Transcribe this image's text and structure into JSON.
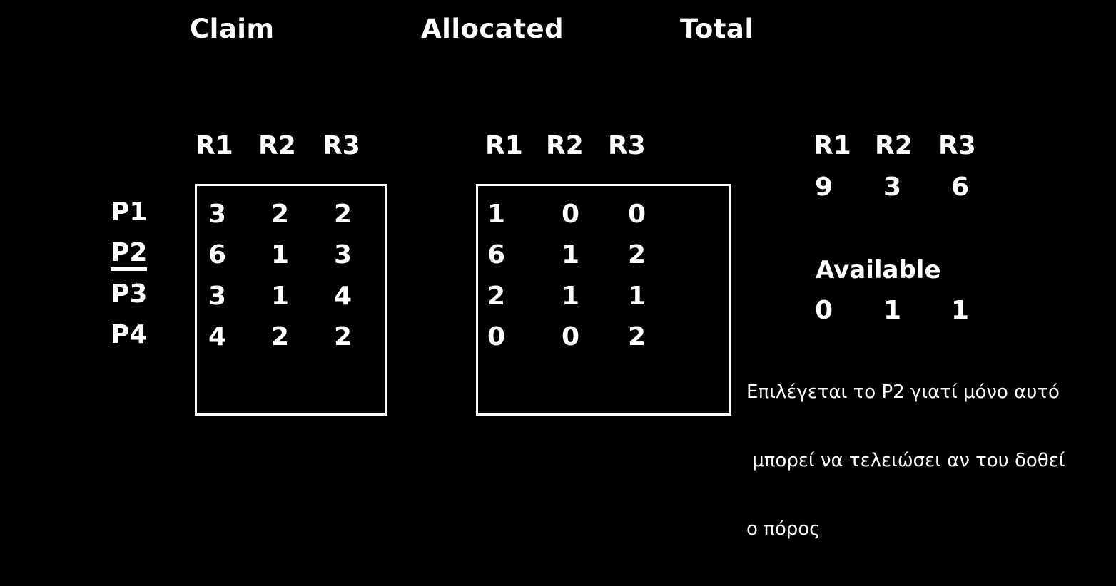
{
  "slide": {
    "background_color": "#000000",
    "text_color": "#ffffff"
  },
  "sections": {
    "claim": {
      "caption": "Claim",
      "resource_headers": [
        "R1",
        "R2",
        "R3"
      ],
      "process_labels": [
        "P1",
        "P2",
        "P3",
        "P4"
      ],
      "selected_process": "P2",
      "rows": [
        [
          "3",
          "2",
          "2"
        ],
        [
          "6",
          "1",
          "3"
        ],
        [
          "3",
          "1",
          "4"
        ],
        [
          "4",
          "2",
          "2"
        ]
      ]
    },
    "allocated": {
      "caption": "Allocated",
      "resource_headers": [
        "R1",
        "R2",
        "R3"
      ],
      "rows": [
        [
          "1",
          "0",
          "0"
        ],
        [
          "6",
          "1",
          "2"
        ],
        [
          "2",
          "1",
          "1"
        ],
        [
          "0",
          "0",
          "2"
        ]
      ]
    },
    "total": {
      "caption": "Total",
      "resource_headers": [
        "R1",
        "R2",
        "R3"
      ],
      "values": [
        "9",
        "3",
        "6"
      ],
      "available_caption": "Available",
      "available_values": [
        "0",
        "1",
        "1"
      ]
    }
  },
  "note": {
    "line1": "Επιλέγεται το P2 γιατί μόνο αυτό",
    "line2": " μπορεί να τελειώσει αν του δοθεί",
    "line3": "ο πόρος"
  }
}
